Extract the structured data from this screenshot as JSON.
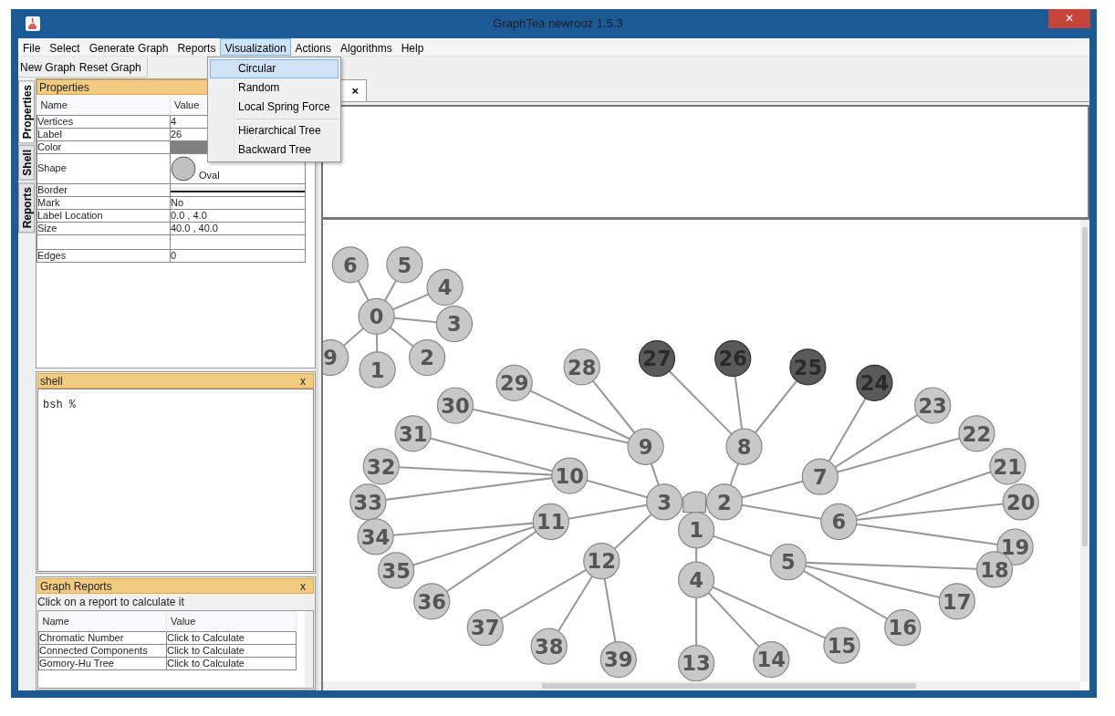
{
  "window": {
    "title": "GraphTea newrooz 1.5.3",
    "close": "✕"
  },
  "menu_bar": [
    {
      "label": "File",
      "selected": false
    },
    {
      "label": "Select",
      "selected": false
    },
    {
      "label": "Generate Graph",
      "selected": false
    },
    {
      "label": "Reports",
      "selected": false
    },
    {
      "label": "Visualization",
      "selected": true
    },
    {
      "label": "Actions",
      "selected": false
    },
    {
      "label": "Algorithms",
      "selected": false
    },
    {
      "label": "Help",
      "selected": false
    }
  ],
  "open_menu": [
    {
      "kind": "item",
      "label": "Circular",
      "selected": true
    },
    {
      "kind": "item",
      "label": "Random",
      "selected": false
    },
    {
      "kind": "item",
      "label": "Local Spring Force",
      "selected": false
    },
    {
      "kind": "separator"
    },
    {
      "kind": "item",
      "label": "Hierarchical Tree",
      "selected": false
    },
    {
      "kind": "item",
      "label": "Backward Tree",
      "selected": false
    }
  ],
  "toolbar": [
    "New Graph",
    "Reset Graph"
  ],
  "side_tabs": [
    {
      "label": "Properties",
      "selected": true
    },
    {
      "label": "Shell",
      "selected": false
    },
    {
      "label": "Reports",
      "selected": false
    }
  ],
  "properties": {
    "title": "Properties",
    "columns": [
      "Name",
      "Value"
    ],
    "rows": [
      {
        "kind": "text",
        "name": "Vertices",
        "value": "4"
      },
      {
        "kind": "text",
        "name": "Label",
        "value": "26"
      },
      {
        "kind": "color",
        "name": "Color",
        "color": "#808080"
      },
      {
        "kind": "shape",
        "name": "Shape",
        "value": "Oval"
      },
      {
        "kind": "border",
        "name": "Border"
      },
      {
        "kind": "text",
        "name": "Mark",
        "value": "No"
      },
      {
        "kind": "text",
        "name": "Label Location",
        "value": "0.0 , 4.0"
      },
      {
        "kind": "text",
        "name": "Size",
        "value": "40.0 , 40.0"
      },
      {
        "kind": "blank"
      },
      {
        "kind": "text",
        "name": "Edges",
        "value": "0"
      }
    ]
  },
  "shell": {
    "title": "shell",
    "close": "x",
    "prompt": "bsh %"
  },
  "graph_reports": {
    "title": "Graph Reports",
    "close": "x",
    "hint": "Click on a report to calculate it",
    "columns": [
      "Name",
      "Value"
    ],
    "rows": [
      {
        "name": "Chromatic Number",
        "value": "Click to Calculate"
      },
      {
        "name": "Connected Components",
        "value": "Click to Calculate"
      },
      {
        "name": "Gomory-Hu Tree",
        "value": "Click to Calculate"
      }
    ]
  },
  "document_tab": {
    "close": "×"
  },
  "graphs": [
    {
      "root": {
        "label": "0",
        "selected": false,
        "children": [
          {
            "label": "6",
            "selected": false
          },
          {
            "label": "5",
            "selected": false
          },
          {
            "label": "4",
            "selected": false
          },
          {
            "label": "3",
            "selected": false
          },
          {
            "label": "9",
            "selected": false
          },
          {
            "label": "2",
            "selected": false
          },
          {
            "label": "1",
            "selected": false
          }
        ]
      }
    },
    {
      "root": {
        "selected": false,
        "children": [
          {
            "label": "3",
            "selected": false,
            "children": [
              {
                "label": "9",
                "selected": false,
                "children": [
                  {
                    "label": "28",
                    "selected": false
                  },
                  {
                    "label": "29",
                    "selected": false
                  },
                  {
                    "label": "30",
                    "selected": false
                  }
                ]
              },
              {
                "label": "10",
                "selected": false,
                "children": [
                  {
                    "label": "31",
                    "selected": false
                  },
                  {
                    "label": "32",
                    "selected": false
                  },
                  {
                    "label": "33",
                    "selected": false
                  }
                ]
              },
              {
                "label": "11",
                "selected": false,
                "children": [
                  {
                    "label": "34",
                    "selected": false
                  },
                  {
                    "label": "35",
                    "selected": false
                  },
                  {
                    "label": "36",
                    "selected": false
                  }
                ]
              },
              {
                "label": "12",
                "selected": false,
                "children": [
                  {
                    "label": "37",
                    "selected": false
                  },
                  {
                    "label": "38",
                    "selected": false
                  },
                  {
                    "label": "39",
                    "selected": false
                  }
                ]
              }
            ]
          },
          {
            "label": "2",
            "selected": false,
            "children": [
              {
                "label": "8",
                "selected": false,
                "children": [
                  {
                    "label": "27",
                    "selected": true
                  },
                  {
                    "label": "26",
                    "selected": true
                  },
                  {
                    "label": "25",
                    "selected": true
                  }
                ]
              },
              {
                "label": "7",
                "selected": false,
                "children": [
                  {
                    "label": "24",
                    "selected": true
                  },
                  {
                    "label": "23",
                    "selected": false
                  },
                  {
                    "label": "22",
                    "selected": false
                  }
                ]
              },
              {
                "label": "6",
                "selected": false,
                "children": [
                  {
                    "label": "21",
                    "selected": false
                  },
                  {
                    "label": "20",
                    "selected": false
                  },
                  {
                    "label": "19",
                    "selected": false
                  }
                ]
              }
            ]
          },
          {
            "label": "1",
            "selected": false,
            "children": [
              {
                "label": "5",
                "selected": false,
                "children": [
                  {
                    "label": "18",
                    "selected": false
                  },
                  {
                    "label": "17",
                    "selected": false
                  },
                  {
                    "label": "16",
                    "selected": false
                  }
                ]
              },
              {
                "label": "4",
                "selected": false,
                "children": [
                  {
                    "label": "15",
                    "selected": false
                  },
                  {
                    "label": "13",
                    "selected": false
                  },
                  {
                    "label": "14",
                    "selected": false
                  }
                ]
              }
            ]
          }
        ]
      }
    }
  ]
}
